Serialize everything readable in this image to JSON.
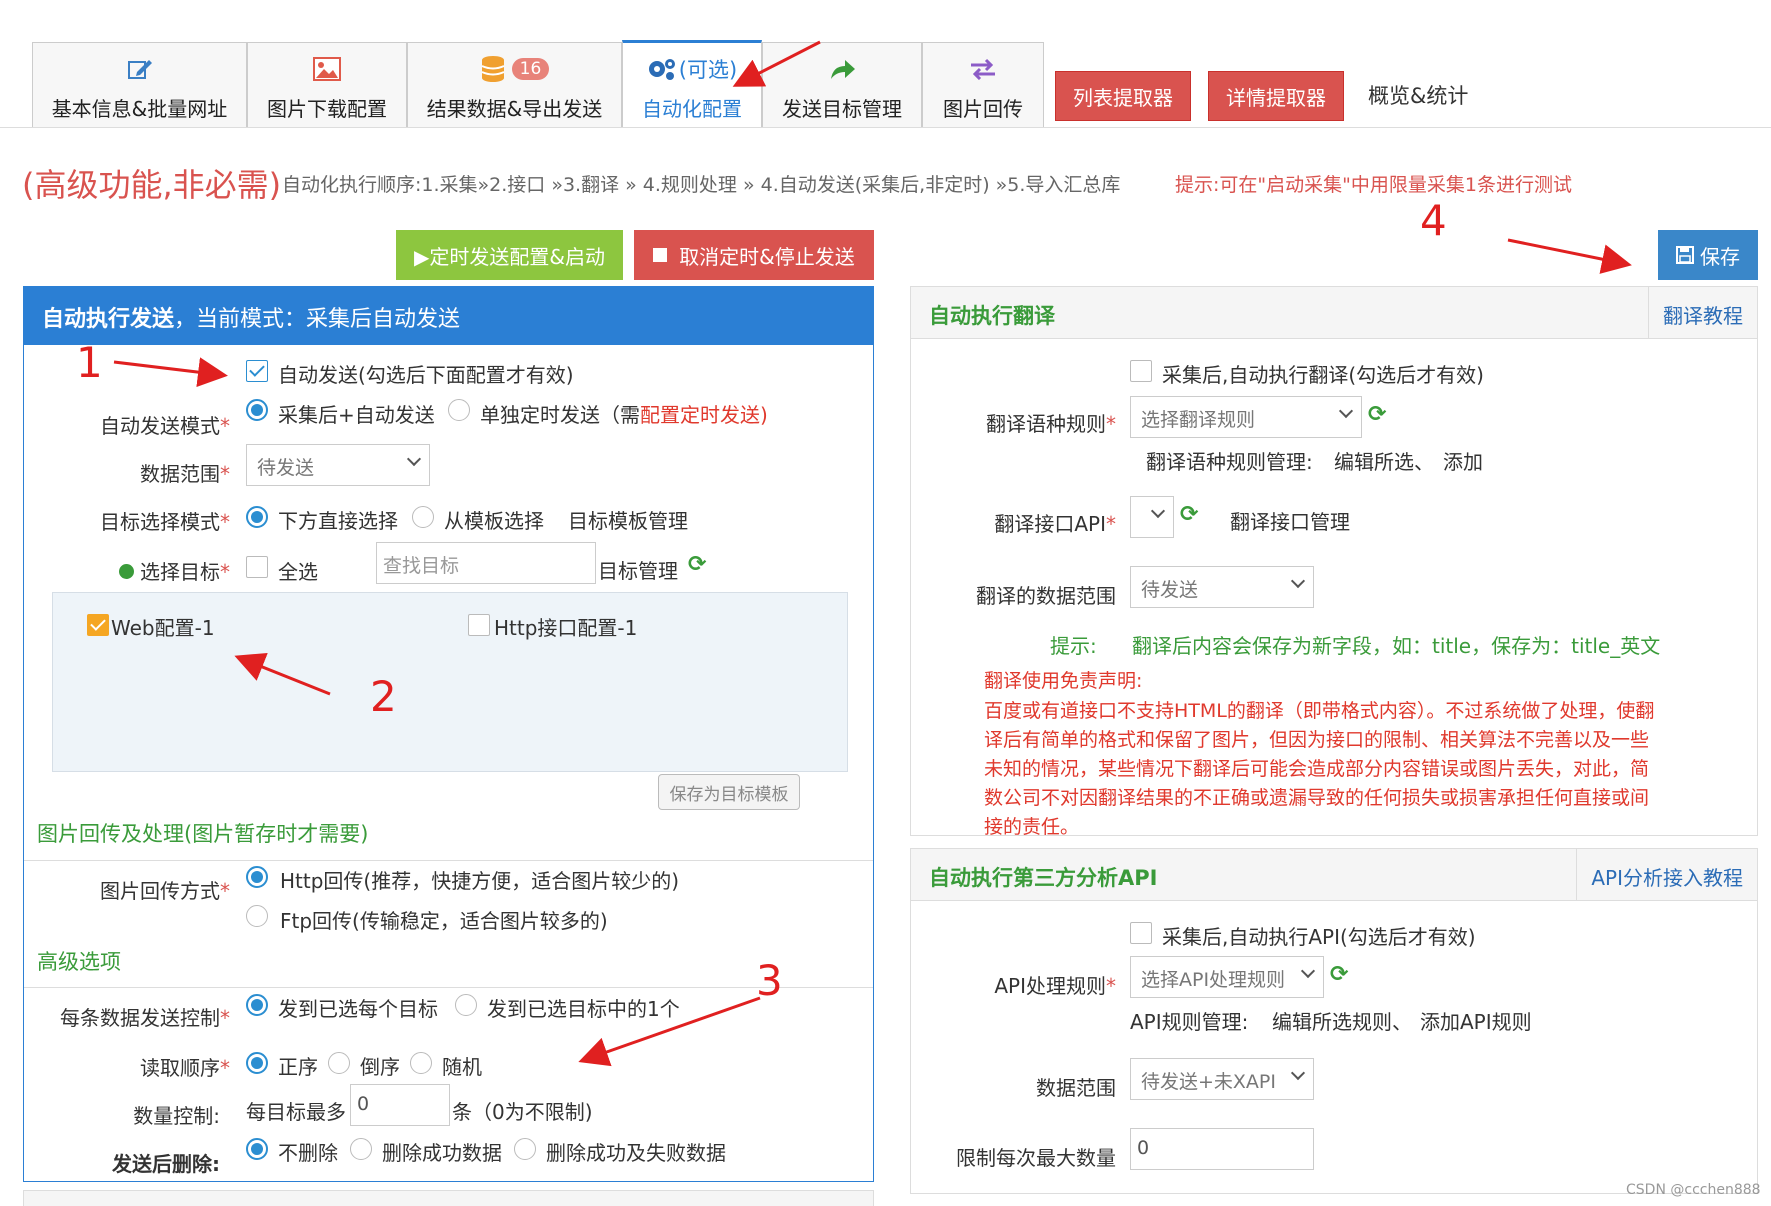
{
  "tabs": [
    {
      "label": "基本信息&批量网址",
      "icon": "edit-icon"
    },
    {
      "label": "图片下载配置",
      "icon": "image-icon"
    },
    {
      "label": "结果数据&导出发送",
      "icon": "database-icon",
      "badge": "16"
    },
    {
      "label": "自动化配置",
      "icon": "gears-icon",
      "sub": "(可选)"
    },
    {
      "label": "发送目标管理",
      "icon": "share-icon"
    },
    {
      "label": "图片回传",
      "icon": "exchange-icon"
    }
  ],
  "header_buttons": {
    "list_extractor": "列表提取器",
    "detail_extractor": "详情提取器",
    "overview": "概览&统计"
  },
  "intro": {
    "title": "(高级功能,非必需)",
    "order": "自动化执行顺序:1.采集»2.接口 »3.翻译 » 4.规则处理 » 4.自动发送(采集后,非定时) »5.导入汇总库",
    "tip": "提示:可在\"启动采集\"中用限量采集1条进行测试"
  },
  "actions": {
    "schedule": "▶定时发送配置&启动",
    "cancel": "取消定时&停止发送",
    "save": "保存"
  },
  "send_panel": {
    "title_bold": "自动执行发送",
    "title_rest": "，当前模式：采集后自动发送",
    "auto_send_label": "自动发送(勾选后下面配置才有效)",
    "mode_label": "自动发送模式",
    "mode_opt1": "采集后+自动发送",
    "mode_opt2": "单独定时发送（需",
    "mode_opt2_link": "配置定时发送)",
    "range_label": "数据范围",
    "range_value": "待发送",
    "target_mode_label": "目标选择模式",
    "target_opt1": "下方直接选择",
    "target_opt2": "从模板选择",
    "target_template_link": "目标模板管理",
    "select_target_label": "选择目标",
    "select_all": "全选",
    "search_placeholder": "查找目标",
    "target_manage_link": "目标管理",
    "targets": [
      "Web配置-1",
      "Http接口配置-1"
    ],
    "save_template": "保存为目标模板",
    "image_section": "图片回传及处理(图片暂存时才需要)",
    "image_mode_label": "图片回传方式",
    "image_opt1": "Http回传(推荐，快捷方便，适合图片较少的)",
    "image_opt2": "Ftp回传(传输稳定，适合图片较多的)",
    "adv_section": "高级选项",
    "per_data_label": "每条数据发送控制",
    "per_opt1": "发到已选每个目标",
    "per_opt2": "发到已选目标中的1个",
    "order_label": "读取顺序",
    "order_opts": [
      "正序",
      "倒序",
      "随机"
    ],
    "count_label": "数量控制:",
    "count_prefix": "每目标最多",
    "count_value": "0",
    "count_suffix": "条（0为不限制)",
    "delete_label": "发送后删除:",
    "delete_opts": [
      "不删除",
      "删除成功数据",
      "删除成功及失败数据"
    ]
  },
  "translate_panel": {
    "title": "自动执行翻译",
    "help": "翻译教程",
    "enable_label": "采集后,自动执行翻译(勾选后才有效)",
    "rule_label": "翻译语种规则",
    "rule_placeholder": "选择翻译规则",
    "rule_manage": "翻译语种规则管理:",
    "edit_selected": "编辑所选、",
    "add": "添加",
    "api_label": "翻译接口API",
    "api_manage": "翻译接口管理",
    "range_label": "翻译的数据范围",
    "range_value": "待发送",
    "hint_label": "提示:",
    "hint_text": "翻译后内容会保存为新字段，如：title，保存为：title_英文",
    "disclaimer_title": "翻译使用免责声明:",
    "disclaimer_lines": [
      "百度或有道接口不支持HTML的翻译（即带格式内容）。不过系统做了处理，使翻",
      "译后有简单的格式和保留了图片，但因为接口的限制、相关算法不完善以及一些",
      "未知的情况，某些情况下翻译后可能会造成部分内容错误或图片丢失，对此，简",
      "数公司不对因翻译结果的不正确或遗漏导致的任何损失或损害承担任何直接或间",
      "接的责任。"
    ]
  },
  "api_panel": {
    "title": "自动执行第三方分析API",
    "help": "API分析接入教程",
    "enable_label": "采集后,自动执行API(勾选后才有效)",
    "rule_label": "API处理规则",
    "rule_placeholder": "选择API处理规则",
    "rule_manage": "API规则管理:",
    "edit_selected": "编辑所选规则、",
    "add": "添加API规则",
    "range_label": "数据范围",
    "range_value": "待发送+未XAPI",
    "limit_label": "限制每次最大数量",
    "limit_value": "0"
  },
  "annotations": [
    "1",
    "2",
    "3",
    "4"
  ],
  "watermark": "CSDN @ccchen888",
  "colors": {
    "accent": "#2b7fd4",
    "green": "#3a9b3a",
    "red": "#d9534f",
    "olive": "#8dc63f"
  }
}
